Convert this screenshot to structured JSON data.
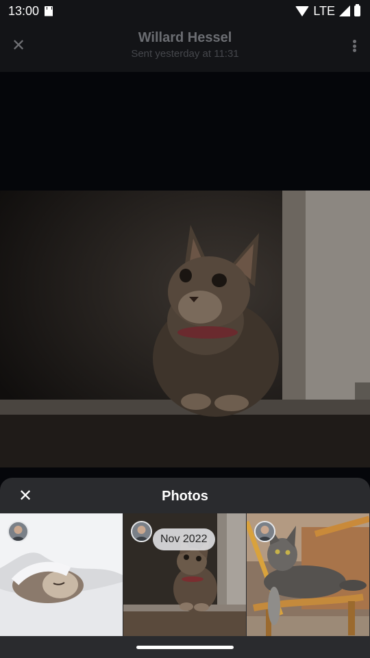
{
  "status_bar": {
    "time": "13:00",
    "network": "LTE",
    "icons": [
      "sd-card-icon",
      "wifi-icon",
      "signal-icon",
      "battery-icon"
    ]
  },
  "header": {
    "title": "Willard Hessel",
    "subtitle": "Sent yesterday at 11:31",
    "close_icon": "close-icon",
    "more_icon": "more-vert-icon"
  },
  "main_photo": {
    "subject": "cat-photo"
  },
  "sheet": {
    "title": "Photos",
    "close_icon": "close-icon",
    "date_chip": "Nov 2022",
    "thumbnails": [
      {
        "subject": "sleeping-cat-photo"
      },
      {
        "subject": "cat-on-floor-photo"
      },
      {
        "subject": "cat-on-chair-photo"
      }
    ]
  },
  "colors": {
    "background": "#05060a",
    "app_bar": "#131417",
    "sheet": "#2a2b2e",
    "chip": "#dcdcde"
  }
}
